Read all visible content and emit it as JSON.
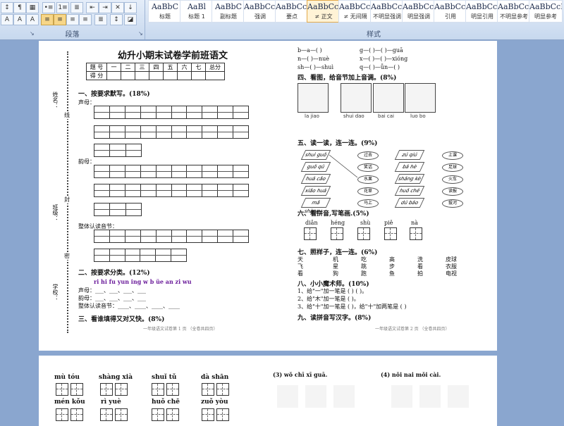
{
  "ribbon": {
    "paragraph_group_label": "段落",
    "styles_group_label": "样式",
    "styles": [
      {
        "sample": "AaBbC",
        "name": "标题"
      },
      {
        "sample": "AaBl",
        "name": "标题 1"
      },
      {
        "sample": "AaBbC",
        "name": "副标题"
      },
      {
        "sample": "AaBbCcD",
        "name": "强调"
      },
      {
        "sample": "AaBbCcD",
        "name": "要点"
      },
      {
        "sample": "AaBbCcDd",
        "name": "≠ 正文"
      },
      {
        "sample": "AaBbCcDd",
        "name": "≠ 无间隔"
      },
      {
        "sample": "AaBbCcDd",
        "name": "不明显强调"
      },
      {
        "sample": "AaBbCcDd",
        "name": "明显强调"
      },
      {
        "sample": "AaBbCcD",
        "name": "引用"
      },
      {
        "sample": "AaBbCcD",
        "name": "明显引用"
      },
      {
        "sample": "AaBbCcD",
        "name": "不明显参考"
      },
      {
        "sample": "AaBbCcD",
        "name": "明显参考"
      }
    ],
    "active_style_index": 5
  },
  "page1": {
    "title": "幼升小期末试卷学前班语文",
    "score_table": {
      "header": [
        "题 号",
        "一",
        "二",
        "三",
        "四",
        "五",
        "六",
        "七",
        "总分"
      ],
      "row2_label": "得 分"
    },
    "side_labels": [
      "姓名：",
      "班级：",
      "学校："
    ],
    "side_marks": [
      "线",
      "封",
      "密"
    ],
    "q1": "一、按要求默写。(18%)",
    "q1_shengmu": "声母：",
    "q1_yunmu": "韵母：",
    "q1_zhengti": "整体认读音节：",
    "q2": "二、按要求分类。(12%)",
    "q2_items": "ri   hi   fu   yun   ing   w   b   üe   an   zi   wu",
    "q2_lines": [
      "声母：___、___、___、___",
      "韵母：___、___、___、___",
      "整体认读音节：____、____、____、____"
    ],
    "q3": "三、看谁填得又对又快。(8%)",
    "footer1": "一年级语文试卷第 1 页   （全卷共四页）",
    "footer2": "一年级语文试卷第 2 页   （全卷共四页）",
    "right_top": [
      "b—a—(      )",
      "g—(      )—(      )—guā",
      "n—(      )—nuè",
      "x—(      )—(      )—xióng",
      "sh—(      )—shuì",
      "q—(      )—ǚn—(      )"
    ],
    "q4": "四、看图，给音节加上音调。(8%)",
    "q4_pinyin": [
      "la  jiao",
      "shui  dao",
      "bai  cai",
      "luo  bo"
    ],
    "q5": "五、读一读，连一连。(9%)",
    "q5_left": [
      "shuì guǒ",
      "guǒ qū",
      "huā cǎo",
      "xiǎo huā",
      "mǎ shàng"
    ],
    "q5_left_ovals": [
      "过去",
      "笑话",
      "水果",
      "花草",
      "马上"
    ],
    "q5_right": [
      "zú qiú",
      "bā hè",
      "shāng kè",
      "huǒ chē",
      "dú bāo"
    ],
    "q5_right_ovals": [
      "上课",
      "足球",
      "火车",
      "读报",
      "拔河"
    ],
    "q6": "六、看拼音,写笔画.(5%)",
    "q6_items": [
      "diǎn",
      "héng",
      "shù",
      "piě",
      "nà"
    ],
    "q7": "七、照样子，连一连。(6%)",
    "q7_rows": [
      [
        "天",
        "机",
        "吃",
        "高",
        "洗",
        "皮球"
      ],
      [
        "飞",
        "星",
        "跳",
        "步",
        "看",
        "衣服"
      ],
      [
        "看",
        "狗",
        "跑",
        "鱼",
        "拍",
        "电视"
      ]
    ],
    "q8": "八、小小魔术师。(10%)",
    "q8_lines": [
      "1、给\"一\"加一笔是 (    ) (    )。",
      "2、给\"木\"加一笔是 (    )。",
      "3、给\"十\"加一笔是 (    )，给\"十\"加两笔是 (    )"
    ],
    "q9": "九、读拼音写汉字。(8%)"
  },
  "page2": {
    "pinyin_row1": [
      "mù  tóu",
      "shàng  xià",
      "shuǐ  tǔ",
      "dà  shān"
    ],
    "pinyin_row2": [
      "mén  kǒu",
      "rì  yuè",
      "huǒ  chē",
      "zuǒ  yòu"
    ],
    "right_items": [
      "(3)  wǒ  chī  xī  guā.",
      "(4) nǒi  nai  mǒi  cài."
    ]
  }
}
